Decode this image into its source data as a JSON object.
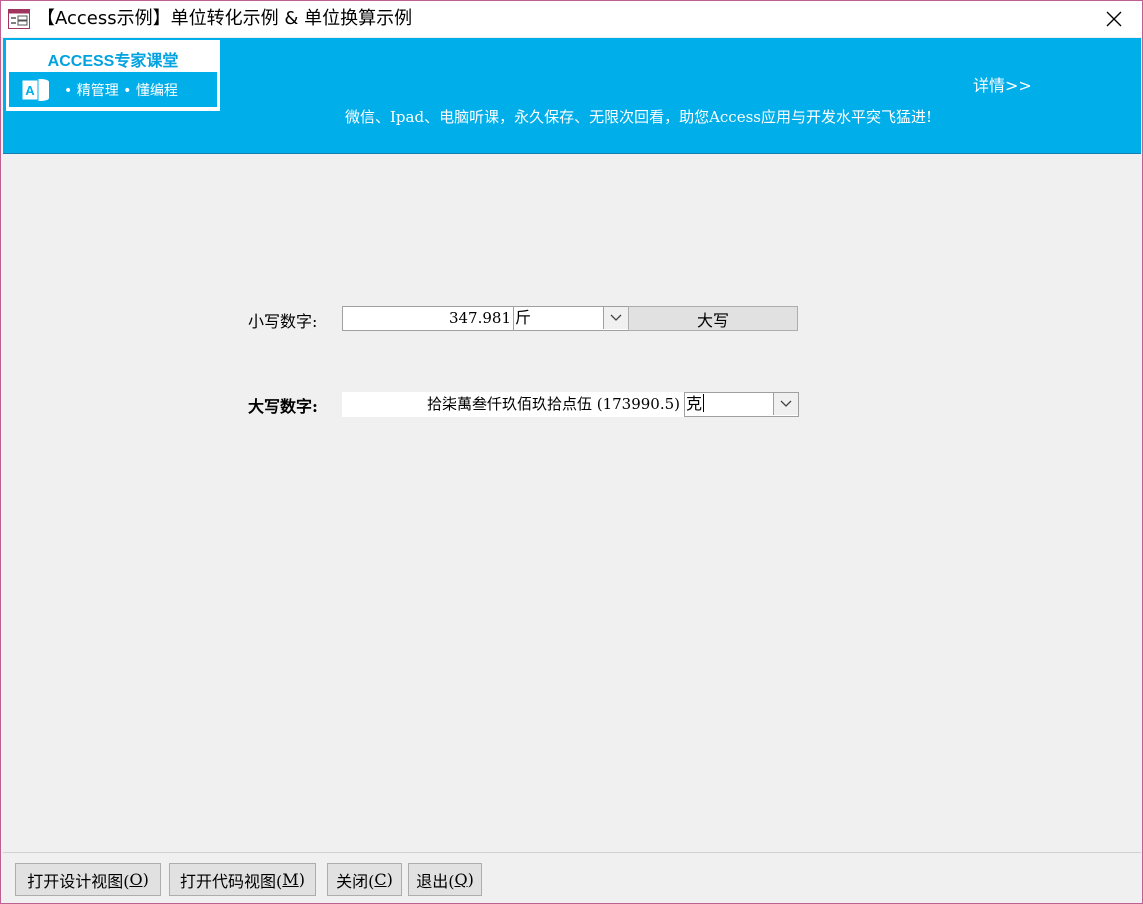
{
  "window": {
    "title": "【Access示例】单位转化示例 & 单位换算示例",
    "close_label": "×"
  },
  "banner": {
    "logo_title": "ACCESS专家课堂",
    "logo_sub_1": "精管理",
    "logo_sub_2": "懂编程",
    "detail_link": "详情>>",
    "promo": "微信、Ipad、电脑听课，永久保存、无限次回看，助您Access应用与开发水平突飞猛进!"
  },
  "form": {
    "lower_label": "小写数字:",
    "lower_value": "347.981",
    "lower_unit": "斤",
    "convert_button": "大写",
    "upper_label": "大写数字:",
    "upper_value": "拾柒萬叁仟玖佰玖拾点伍  (173990.5)",
    "upper_unit": "克"
  },
  "footer": {
    "buttons": [
      {
        "label": "打开设计视图(",
        "key": "O",
        "suffix": ")"
      },
      {
        "label": "打开代码视图(",
        "key": "M",
        "suffix": ")"
      },
      {
        "label": "关闭(",
        "key": "C",
        "suffix": ")"
      },
      {
        "label": "退出(",
        "key": "Q",
        "suffix": ")"
      }
    ]
  },
  "colors": {
    "banner": "#00aeea",
    "window_border": "#c06090",
    "form_background": "#f0f0f0"
  }
}
